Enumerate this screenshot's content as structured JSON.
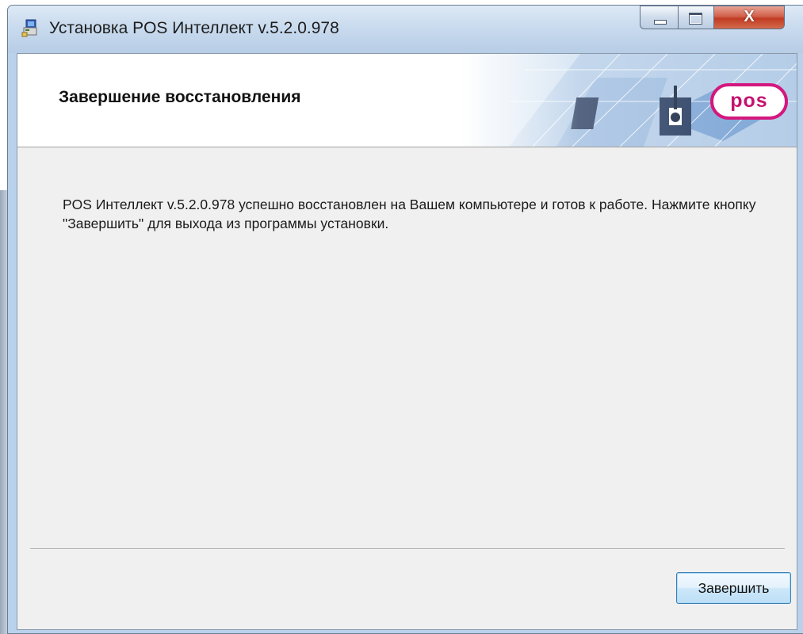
{
  "window": {
    "title": "Установка POS Интеллект v.5.2.0.978",
    "icon": "installer-icon",
    "controls": {
      "minimize": "minimize-icon",
      "maximize": "maximize-icon",
      "close_glyph": "X"
    }
  },
  "banner": {
    "title": "Завершение восстановления",
    "logo_text": "pos",
    "logo_color": "#d4177f"
  },
  "content": {
    "message": "POS Интеллект v.5.2.0.978 успешно восстановлен на Вашем компьютере и готов к работе. Нажмите кнопку \"Завершить\" для выхода из программы установки."
  },
  "footer": {
    "finish_label": "Завершить"
  }
}
